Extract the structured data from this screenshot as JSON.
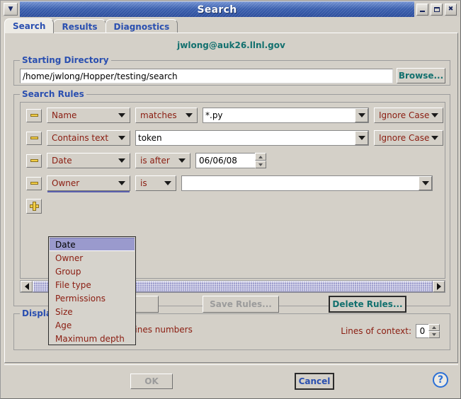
{
  "window": {
    "title": "Search",
    "sysmenu_icon": "chevron-down-icon",
    "minimize_label": "",
    "maximize_label": "",
    "close_label": "✖"
  },
  "tabs": [
    {
      "label": "Search",
      "active": true
    },
    {
      "label": "Results",
      "active": false
    },
    {
      "label": "Diagnostics",
      "active": false
    }
  ],
  "host": "jwlong@auk26.llnl.gov",
  "starting_directory": {
    "legend": "Starting Directory",
    "value": "/home/jwlong/Hopper/testing/search",
    "browse_label": "Browse..."
  },
  "search_rules": {
    "legend": "Search Rules",
    "rows": [
      {
        "remove_icon": "minus-icon",
        "field": "Name",
        "operator": "matches",
        "value": "*.py",
        "modifier": "Ignore Case"
      },
      {
        "remove_icon": "minus-icon",
        "field": "Contains text",
        "operator": "",
        "value": "token",
        "modifier": "Ignore Case"
      },
      {
        "remove_icon": "minus-icon",
        "field": "Date",
        "operator": "is after",
        "value": "06/06/08",
        "modifier": ""
      },
      {
        "remove_icon": "minus-icon",
        "field": "Owner",
        "operator": "is",
        "value": "",
        "modifier": ""
      }
    ],
    "add_icon": "plus-icon",
    "open_dropdown": {
      "selected": "Date",
      "items": [
        "Date",
        "Owner",
        "Group",
        "File type",
        "Permissions",
        "Size",
        "Age",
        "Maximum depth"
      ]
    },
    "buttons": {
      "load_label": "",
      "save_label": "Save Rules...",
      "delete_label": "Delete Rules..."
    },
    "scrollbar": {
      "left_arrow_icon": "arrow-left-icon",
      "right_arrow_icon": "arrow-right-icon"
    }
  },
  "display_options": {
    "legend": "Display Options",
    "checkbox_label": "Display lines numbers",
    "checkbox_checked": "✔",
    "context_label": "Lines of context:",
    "context_value": "0"
  },
  "footer": {
    "ok_label": "OK",
    "cancel_label": "Cancel",
    "help_label": "?"
  },
  "colors": {
    "title_bar": "#2c4d9c",
    "accent_blue": "#2a4fb0",
    "teal": "#12706e",
    "maroon": "#8a1c10",
    "face": "#d4d0c8",
    "highlight": "#9a9acd"
  }
}
